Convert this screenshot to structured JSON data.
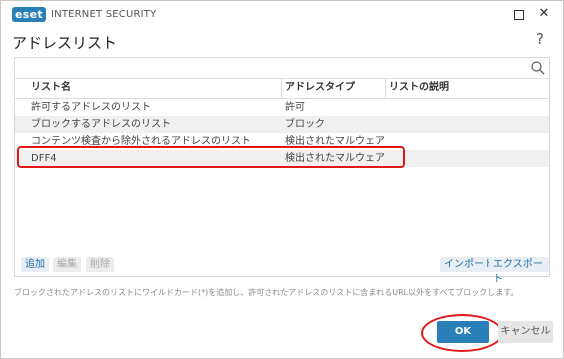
{
  "titlebar": {
    "logo": "eset",
    "product": "INTERNET SECURITY",
    "minimize_icon": "square-icon",
    "close_icon": "close-icon"
  },
  "dialog": {
    "title": "アドレスリスト",
    "help": "?"
  },
  "table": {
    "columns": [
      "リスト名",
      "アドレスタイプ",
      "リストの説明"
    ],
    "rows": [
      {
        "name": "許可するアドレスのリスト",
        "type": "許可",
        "desc": ""
      },
      {
        "name": "ブロックするアドレスのリスト",
        "type": "ブロック",
        "desc": ""
      },
      {
        "name": "コンテンツ検査から除外されるアドレスのリスト",
        "type": "検出されたマルウェアは無...",
        "desc": ""
      },
      {
        "name": "DFF4",
        "type": "検出されたマルウェアは無...",
        "desc": ""
      }
    ]
  },
  "toolbar": {
    "add": "追加",
    "edit": "編集",
    "delete": "削除",
    "import": "インポート",
    "export": "エクスポート"
  },
  "description": "ブロックされたアドレスのリストにワイルドカード(*)を追加し、許可されたアドレスのリストに含まれるURL以外をすべてブロックします。",
  "footer": {
    "ok": "OK",
    "cancel": "キャンセル"
  },
  "colors": {
    "accent": "#2a7fb8",
    "annotation_red": "#e11818"
  }
}
